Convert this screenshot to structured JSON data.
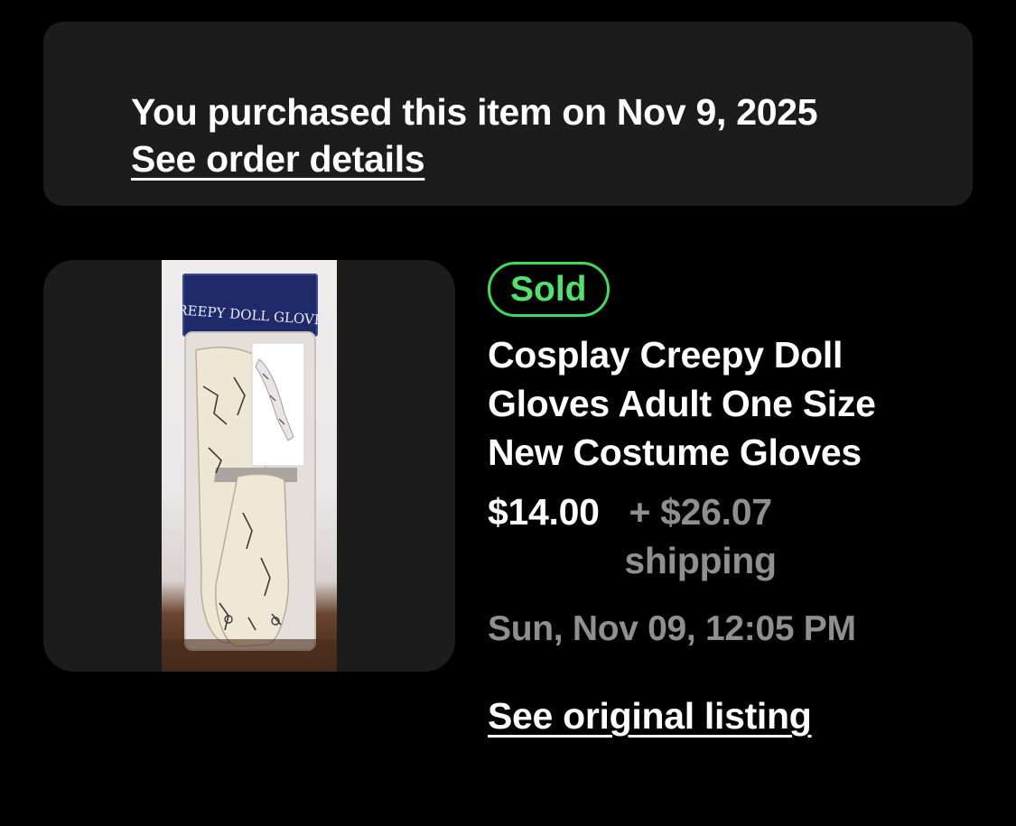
{
  "banner": {
    "purchase_text": "You purchased this item on Nov 9, 2025",
    "order_link": "See order details"
  },
  "item": {
    "image_icon": "product-photo",
    "package_label": "CREEPY DOLL GLOVES",
    "status_badge": "Sold",
    "title": "Cosplay Creepy Doll Gloves Adult One Size New Costume Gloves",
    "price": "$14.00",
    "shipping": "+ $26.07 shipping",
    "sold_date": "Sun, Nov 09, 12:05 PM",
    "original_listing_link": "See original listing"
  },
  "colors": {
    "background": "#000000",
    "card": "#1c1c1c",
    "sold_green": "#3ddc5a",
    "secondary_text": "#8f8f8f",
    "package_header": "#1f2a6b"
  }
}
